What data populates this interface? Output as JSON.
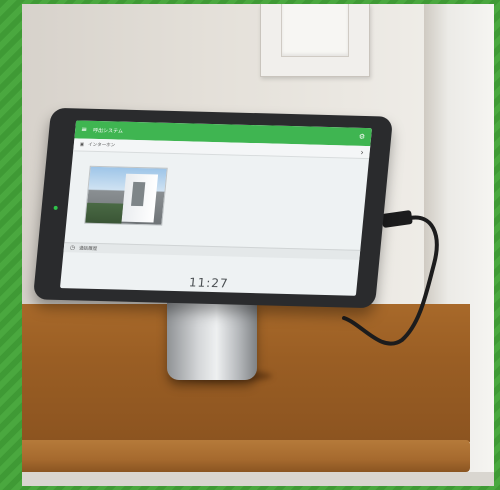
{
  "app": {
    "title": "呼出システム",
    "menu_icon": "menu-icon",
    "settings_icon": "gear-icon"
  },
  "sections": {
    "intercom_label": "インターホン",
    "intercom_icon": "camera-icon",
    "history_label": "通話履歴",
    "history_icon": "clock-icon"
  },
  "status": {
    "time": "11:27"
  },
  "colors": {
    "accent": "#3fb551"
  }
}
